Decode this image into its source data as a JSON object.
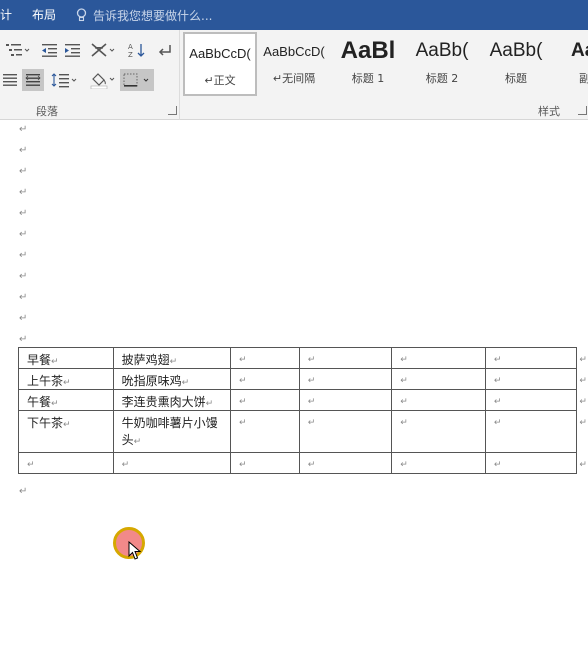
{
  "tabs": [
    {
      "label": "计"
    },
    {
      "label": "布局"
    }
  ],
  "tell_me": {
    "placeholder": "告诉我您想要做什么..."
  },
  "paragraph_group": {
    "label": "段落"
  },
  "styles_group": {
    "label": "样式"
  },
  "styles": [
    {
      "preview": "AaBbCcD(",
      "name": "↵正文",
      "size": 13,
      "bold": false,
      "selected": true
    },
    {
      "preview": "AaBbCcD(",
      "name": "↵无间隔",
      "size": 13,
      "bold": false,
      "selected": false
    },
    {
      "preview": "AaBl",
      "name": "标题 1",
      "size": 24,
      "bold": true,
      "selected": false
    },
    {
      "preview": "AaBb(",
      "name": "标题 2",
      "size": 19,
      "bold": false,
      "selected": false
    },
    {
      "preview": "AaBb(",
      "name": "标题",
      "size": 19,
      "bold": false,
      "selected": false
    },
    {
      "preview": "AaB",
      "name": "副标",
      "size": 19,
      "bold": true,
      "selected": false
    }
  ],
  "document": {
    "paragraph_mark": "↵",
    "table": {
      "rows": [
        {
          "meal": "早餐",
          "food": "披萨鸡翅"
        },
        {
          "meal": "上午茶",
          "food": "吮指原味鸡"
        },
        {
          "meal": "午餐",
          "food": "李连贵熏肉大饼"
        },
        {
          "meal": "下午茶",
          "food": "牛奶咖啡薯片小馒头"
        },
        {
          "meal": "",
          "food": ""
        }
      ]
    }
  }
}
